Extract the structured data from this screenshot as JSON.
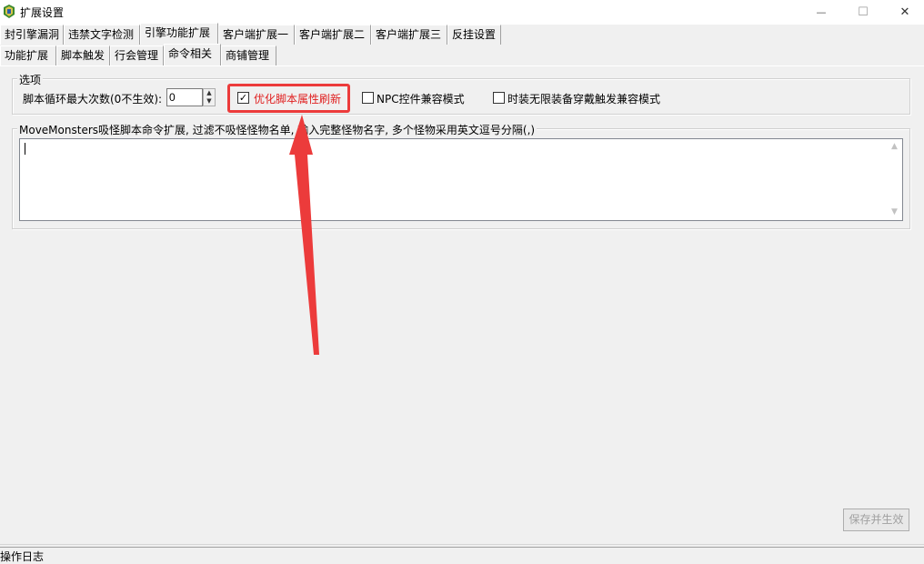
{
  "window": {
    "title": "扩展设置",
    "minimize_glyph": "—",
    "maximize_glyph": "☐",
    "close_glyph": "✕"
  },
  "tabs_main": [
    {
      "label": "封引擎漏洞",
      "active": false
    },
    {
      "label": "违禁文字检测",
      "active": false
    },
    {
      "label": "引擎功能扩展",
      "active": true
    },
    {
      "label": "客户端扩展一",
      "active": false
    },
    {
      "label": "客户端扩展二",
      "active": false
    },
    {
      "label": "客户端扩展三",
      "active": false
    },
    {
      "label": "反挂设置",
      "active": false
    }
  ],
  "tabs_sub": [
    {
      "label": "功能扩展",
      "active": false
    },
    {
      "label": "脚本触发",
      "active": false
    },
    {
      "label": "行会管理",
      "active": false
    },
    {
      "label": "命令相关",
      "active": true
    },
    {
      "label": "商铺管理",
      "active": false
    }
  ],
  "options": {
    "group_title": "选项",
    "loop_label": "脚本循环最大次数(0不生效):",
    "loop_value": "0",
    "checkboxes": [
      {
        "label": "优化脚本属性刷新",
        "checked": true,
        "highlighted": true,
        "color": "#e02020"
      },
      {
        "label": "NPC控件兼容模式",
        "checked": false
      },
      {
        "label": "时装无限装备穿戴触发兼容模式",
        "checked": false
      }
    ]
  },
  "move_monsters": {
    "group_title": "MoveMonsters吸怪脚本命令扩展, 过滤不吸怪怪物名单, 输入完整怪物名字, 多个怪物采用英文逗号分隔(,)",
    "text_value": ""
  },
  "save_button": "保存并生效",
  "log_label": "操作日志",
  "annotation": {
    "arrow_color": "#ec3b3b"
  }
}
